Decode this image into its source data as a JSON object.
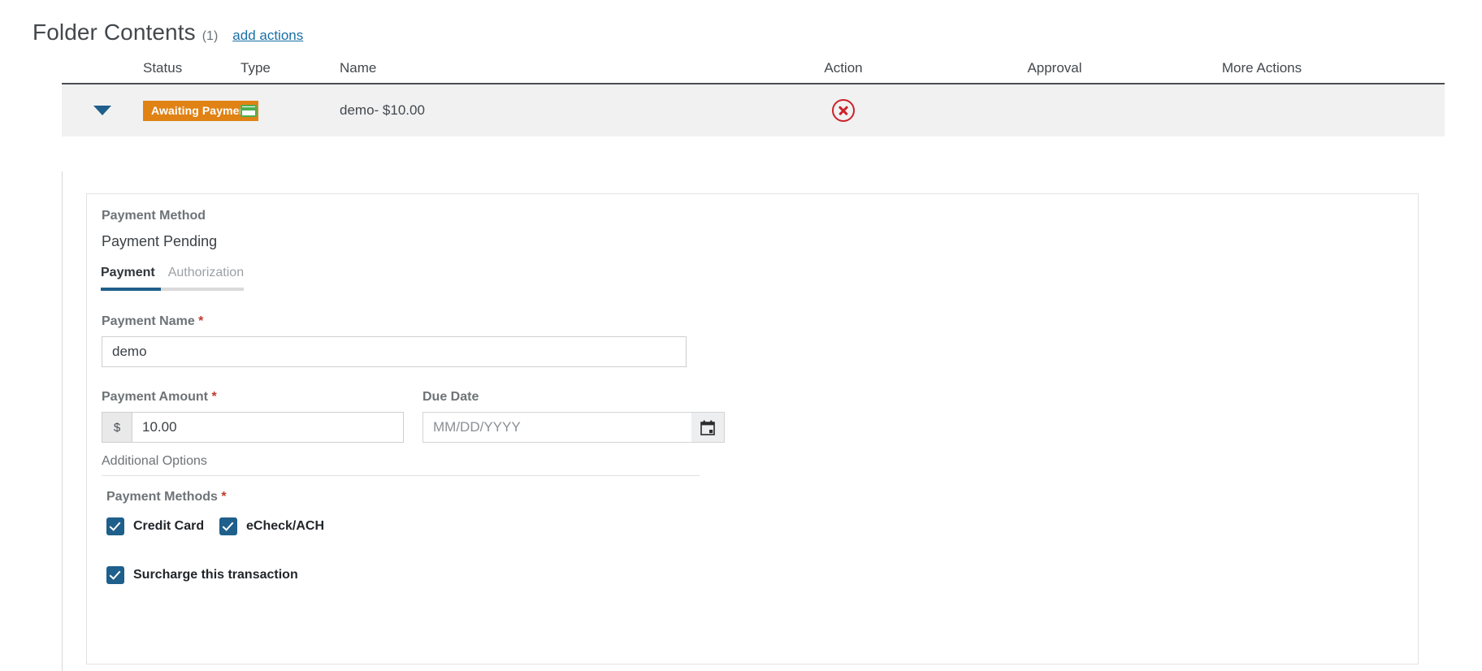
{
  "header": {
    "title": "Folder Contents",
    "count": "(1)",
    "add_actions_label": "add actions"
  },
  "table": {
    "columns": [
      {
        "key": "caret",
        "label": ""
      },
      {
        "key": "status",
        "label": "Status"
      },
      {
        "key": "type",
        "label": "Type"
      },
      {
        "key": "name",
        "label": "Name"
      },
      {
        "key": "action",
        "label": "Action"
      },
      {
        "key": "approval",
        "label": "Approval"
      },
      {
        "key": "more",
        "label": "More Actions"
      }
    ],
    "rows": [
      {
        "expanded": true,
        "caret_icon": "chevron-down-icon",
        "status_badge": "Awaiting Payment",
        "status_badge_color": "#e08214",
        "type_icon": "credit-card-icon",
        "type_icon_color": "#4caf50",
        "name": "demo- $10.00",
        "action_icon": "cancel-circle-icon",
        "action_icon_color": "#cc2229",
        "approval": "",
        "more_actions": ""
      }
    ]
  },
  "detail": {
    "payment_method_label": "Payment Method",
    "payment_method_value": "Payment Pending",
    "tabs": [
      {
        "label": "Payment",
        "active": true
      },
      {
        "label": "Authorization",
        "active": false
      }
    ],
    "payment_name": {
      "label": "Payment Name",
      "required_marker": "*",
      "value": "demo"
    },
    "payment_amount": {
      "label": "Payment Amount",
      "required_marker": "*",
      "currency_symbol": "$",
      "value": "10.00"
    },
    "due_date": {
      "label": "Due Date",
      "placeholder": "MM/DD/YYYY",
      "value": "",
      "calendar_icon": "calendar-icon"
    },
    "additional_options": {
      "title": "Additional Options",
      "payment_methods_label": "Payment Methods",
      "required_marker": "*",
      "checkboxes": [
        {
          "label": "Credit Card",
          "checked": true
        },
        {
          "label": "eCheck/ACH",
          "checked": true
        }
      ],
      "surcharge": {
        "label": "Surcharge this transaction",
        "checked": true
      }
    }
  },
  "theme": {
    "accent_blue": "#1f5f8b",
    "link_blue": "#186fa5",
    "badge_orange": "#e08214",
    "danger_red": "#cc2229",
    "success_green": "#4caf50",
    "row_bg": "#f1f1f1"
  }
}
